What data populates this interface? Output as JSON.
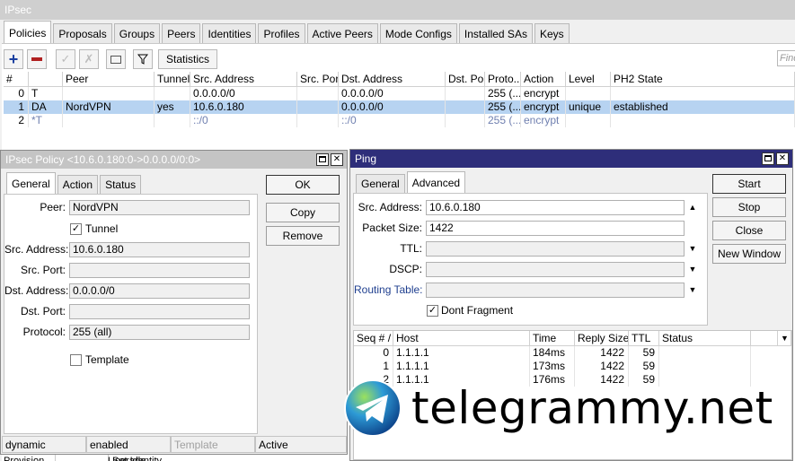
{
  "ipsec": {
    "title": "IPsec",
    "tabs": [
      "Policies",
      "Proposals",
      "Groups",
      "Peers",
      "Identities",
      "Profiles",
      "Active Peers",
      "Mode Configs",
      "Installed SAs",
      "Keys"
    ],
    "toolbar": {
      "statistics": "Statistics",
      "find_placeholder": "Find"
    },
    "columns": [
      "#",
      "",
      "Peer",
      "Tunnel",
      "Src. Address",
      "Src. Port",
      "Dst. Address",
      "Dst. Port",
      "Proto...",
      "Action",
      "Level",
      "PH2 State"
    ],
    "rows": [
      {
        "num": "0",
        "flags": "T",
        "peer": "",
        "tunnel": "",
        "src": "0.0.0.0/0",
        "sport": "",
        "dst": "0.0.0.0/0",
        "dport": "",
        "proto": "255 (...",
        "action": "encrypt",
        "level": "",
        "ph2": ""
      },
      {
        "num": "1",
        "flags": "DA",
        "peer": "NordVPN",
        "tunnel": "yes",
        "src": "10.6.0.180",
        "sport": "",
        "dst": "0.0.0.0/0",
        "dport": "",
        "proto": "255 (...",
        "action": "encrypt",
        "level": "unique",
        "ph2": "established"
      },
      {
        "num": "2",
        "flags": "*T",
        "peer": "",
        "tunnel": "",
        "src": "::/0",
        "sport": "",
        "dst": "::/0",
        "dport": "",
        "proto": "255 (...",
        "action": "encrypt",
        "level": "",
        "ph2": ""
      }
    ],
    "bottom_tabs": [
      "Provision",
      "Upgrade",
      "Set Identity"
    ]
  },
  "policy": {
    "title": "IPsec Policy <10.6.0.180:0->0.0.0.0/0:0>",
    "tabs": [
      "General",
      "Action",
      "Status"
    ],
    "peer_label": "Peer:",
    "peer": "NordVPN",
    "tunnel_label": "Tunnel",
    "src_label": "Src. Address:",
    "src": "10.6.0.180",
    "sport_label": "Src. Port:",
    "dst_label": "Dst. Address:",
    "dst": "0.0.0.0/0",
    "dport_label": "Dst. Port:",
    "proto_label": "Protocol:",
    "proto": "255 (all)",
    "template_label": "Template",
    "buttons": {
      "ok": "OK",
      "copy": "Copy",
      "remove": "Remove"
    },
    "status": [
      "dynamic",
      "enabled",
      "Template",
      "Active"
    ]
  },
  "ping": {
    "title": "Ping",
    "tabs": [
      "General",
      "Advanced"
    ],
    "src_label": "Src. Address:",
    "src": "10.6.0.180",
    "size_label": "Packet Size:",
    "size": "1422",
    "ttl_label": "TTL:",
    "dscp_label": "DSCP:",
    "rt_label": "Routing Table:",
    "df_label": "Dont Fragment",
    "buttons": {
      "start": "Start",
      "stop": "Stop",
      "close": "Close",
      "new_window": "New Window"
    },
    "columns": [
      "Seq # /",
      "Host",
      "Time",
      "Reply Size",
      "TTL",
      "Status"
    ],
    "rows": [
      {
        "seq": "0",
        "host": "1.1.1.1",
        "time": "184ms",
        "size": "1422",
        "ttl": "59",
        "status": ""
      },
      {
        "seq": "1",
        "host": "1.1.1.1",
        "time": "173ms",
        "size": "1422",
        "ttl": "59",
        "status": ""
      },
      {
        "seq": "2",
        "host": "1.1.1.1",
        "time": "176ms",
        "size": "1422",
        "ttl": "59",
        "status": ""
      }
    ]
  },
  "watermark": "telegrammy.net"
}
